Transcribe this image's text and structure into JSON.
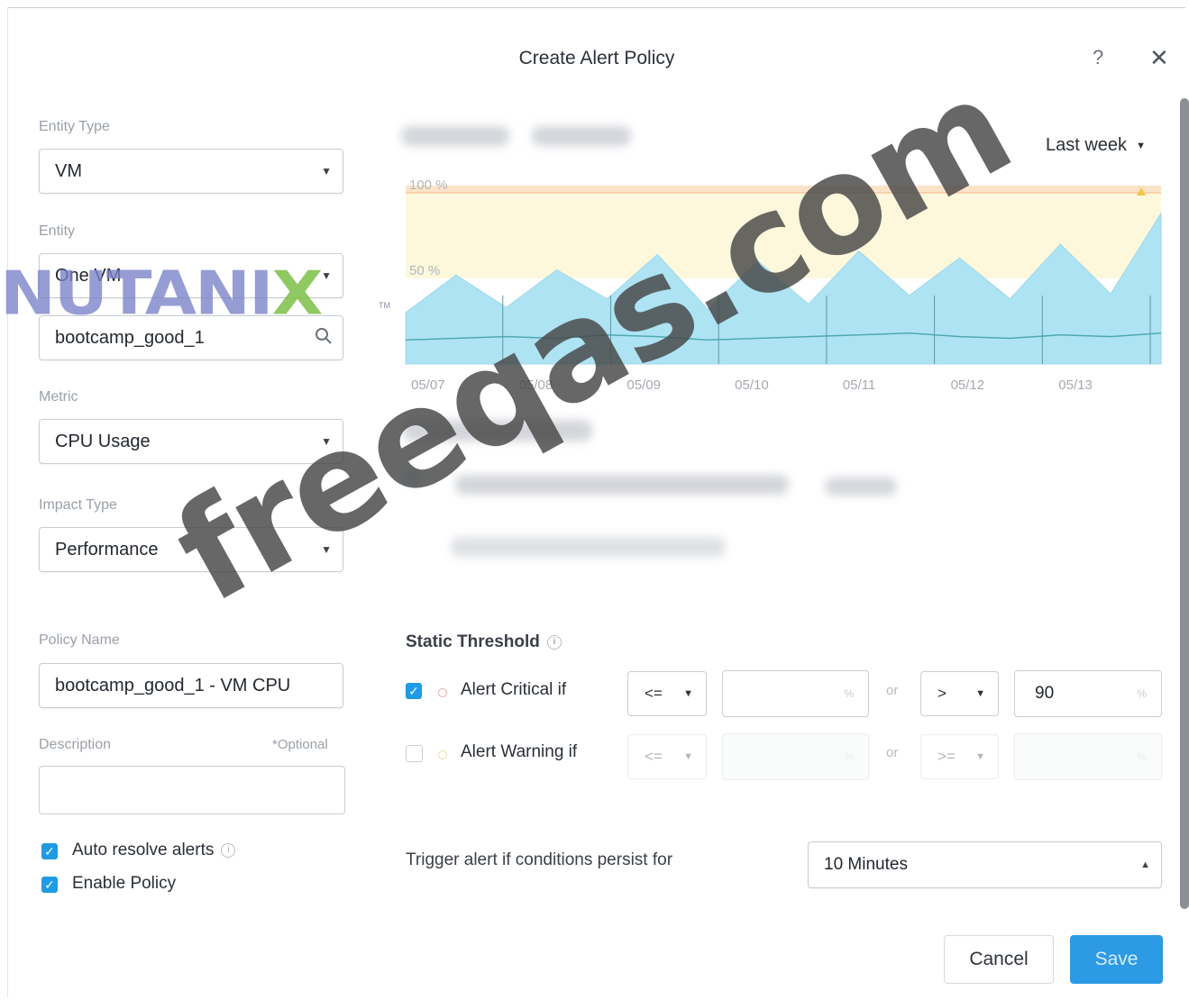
{
  "dialog": {
    "title": "Create Alert Policy",
    "help_glyph": "?",
    "close_glyph": "✕"
  },
  "form": {
    "entity_type": {
      "label": "Entity Type",
      "value": "VM"
    },
    "entity": {
      "label": "Entity",
      "value": "One VM"
    },
    "entity_search": {
      "value": "bootcamp_good_1"
    },
    "metric": {
      "label": "Metric",
      "value": "CPU Usage"
    },
    "impact_type": {
      "label": "Impact Type",
      "value": "Performance"
    },
    "policy_name": {
      "label": "Policy Name",
      "value": "bootcamp_good_1 - VM CPU"
    },
    "description": {
      "label": "Description",
      "optional": "*Optional",
      "value": ""
    },
    "auto_resolve": {
      "label": "Auto resolve alerts",
      "checked": true
    },
    "enable_policy": {
      "label": "Enable Policy",
      "checked": true
    }
  },
  "logo": {
    "text": "NUTANI",
    "x": "X",
    "tm": "TM"
  },
  "chart_data": {
    "type": "area",
    "range_label": "Last week",
    "y_tick_labels": [
      "100 %",
      "50 %"
    ],
    "ylim": [
      0,
      100
    ],
    "x": [
      "05/07",
      "05/08",
      "05/09",
      "05/10",
      "05/11",
      "05/12",
      "05/13"
    ],
    "threshold": 100,
    "series": [
      {
        "values": [
          30,
          52,
          33,
          55,
          38,
          64,
          32,
          60,
          35,
          66,
          40,
          62,
          38,
          70,
          41,
          88
        ]
      },
      {
        "values": [
          14,
          15,
          16,
          15,
          17,
          16,
          14,
          15,
          16,
          17,
          18,
          16,
          15,
          17,
          16,
          18
        ]
      }
    ],
    "colors": {
      "area": "#aee3f3",
      "line": "#4caab3",
      "critical_band": "#fbe3c8",
      "warning_band": "#fdf8dc"
    }
  },
  "threshold": {
    "title": "Static Threshold",
    "critical": {
      "label": "Alert Critical if",
      "checked": true,
      "op1": "<=",
      "val1": "",
      "or": "or",
      "op2": ">",
      "val2": "90",
      "unit": "%"
    },
    "warning": {
      "label": "Alert Warning if",
      "checked": false,
      "op1": "<=",
      "val1": "",
      "or": "or",
      "op2": ">=",
      "val2": "",
      "unit": "%"
    }
  },
  "trigger": {
    "label": "Trigger alert if conditions persist for",
    "value": "10 Minutes"
  },
  "buttons": {
    "cancel": "Cancel",
    "save": "Save"
  },
  "watermark": "freeqas.com",
  "colors": {
    "accent": "#1e9be3",
    "critical_dot": "#f0a6a6",
    "warning_dot": "#e6e29a"
  }
}
